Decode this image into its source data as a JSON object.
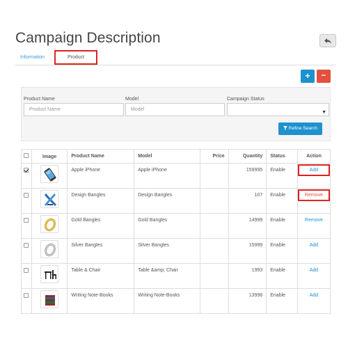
{
  "page": {
    "title": "Campaign Description"
  },
  "tabs": [
    {
      "label": "Information"
    },
    {
      "label": "Product"
    }
  ],
  "toolbar": {
    "add_label": "+",
    "delete_label": "−"
  },
  "filter": {
    "product_name_label": "Product Name",
    "product_name_placeholder": "Product Name",
    "model_label": "Model",
    "model_placeholder": "Model",
    "status_label": "Campaign Status",
    "status_value": "",
    "refine_label": "Refine Search"
  },
  "table": {
    "headers": {
      "image": "Image",
      "name": "Product Name",
      "model": "Model",
      "price": "Price",
      "quantity": "Quantity",
      "status": "Status",
      "action": "Action"
    },
    "rows": [
      {
        "name": "Apple iPhone",
        "model": "Apple iPhone",
        "price": "",
        "quantity": "159995",
        "status": "Enable",
        "action": "Add",
        "checked": true,
        "icon": "iphone-icon"
      },
      {
        "name": "Design Bangles",
        "model": "Design Bangles",
        "price": "",
        "quantity": "107",
        "status": "Enable",
        "action": "Remove",
        "checked": false,
        "icon": "design-bangles-icon"
      },
      {
        "name": "Gold Bangles",
        "model": "Gold Bangles",
        "price": "",
        "quantity": "14999",
        "status": "Enable",
        "action": "Remove",
        "checked": false,
        "icon": "gold-bangle-icon"
      },
      {
        "name": "Silver Bangles",
        "model": "Silver Bangles",
        "price": "",
        "quantity": "15999",
        "status": "Enable",
        "action": "Add",
        "checked": false,
        "icon": "silver-bangle-icon"
      },
      {
        "name": "Table & Chair",
        "model": "Table &amp; Chair",
        "price": "",
        "quantity": "1993",
        "status": "Enable",
        "action": "Add",
        "checked": false,
        "icon": "table-chair-icon"
      },
      {
        "name": "Writing Note-Books",
        "model": "Writing Note-Books",
        "price": "",
        "quantity": "13996",
        "status": "Enable",
        "action": "Add",
        "checked": false,
        "icon": "notebooks-icon"
      }
    ]
  },
  "colors": {
    "primary": "#1e91cf",
    "danger": "#e3503e",
    "highlight": "#e02020"
  }
}
